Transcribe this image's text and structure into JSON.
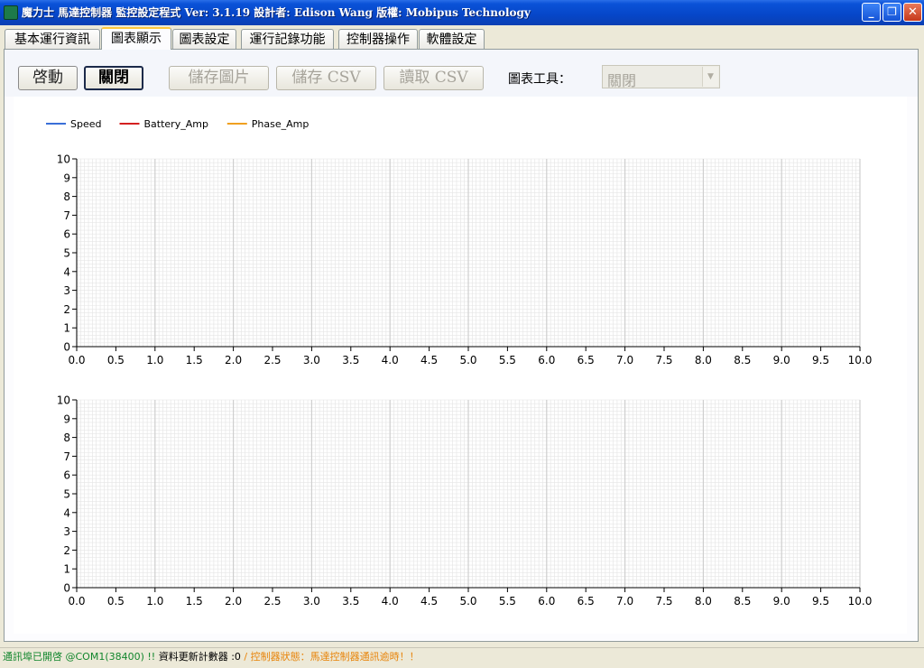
{
  "window": {
    "title": "魔力士 馬達控制器 監控設定程式   Ver: 3.1.19    設計者: Edison Wang  版權: Mobipus  Technology",
    "minimize_glyph": "_",
    "restore_glyph": "❐",
    "close_glyph": "✕"
  },
  "tabs": [
    {
      "label": "基本運行資訊",
      "active": false
    },
    {
      "label": "圖表顯示",
      "active": true
    },
    {
      "label": "圖表設定",
      "active": false
    },
    {
      "label": "運行記錄功能",
      "active": false
    },
    {
      "label": "控制器操作",
      "active": false
    },
    {
      "label": "軟體設定",
      "active": false
    }
  ],
  "toolbar": {
    "start_label": "啓動",
    "close_label": "關閉",
    "save_image_label": "儲存圖片",
    "save_csv_label": "儲存 CSV",
    "read_csv_label": "讀取 CSV",
    "chart_tools_label": "圖表工具：",
    "chart_tools_value": "關閉"
  },
  "chart_data": [
    {
      "type": "line",
      "series": [
        {
          "name": "Speed",
          "color": "#3a6fd8",
          "values": []
        },
        {
          "name": "Battery_Amp",
          "color": "#d42020",
          "values": []
        },
        {
          "name": "Phase_Amp",
          "color": "#f0a020",
          "values": []
        }
      ],
      "legend": "top-left",
      "xlim": [
        0,
        10
      ],
      "ylim": [
        0,
        10
      ],
      "xticks": [
        "0.0",
        "0.5",
        "1.0",
        "1.5",
        "2.0",
        "2.5",
        "3.0",
        "3.5",
        "4.0",
        "4.5",
        "5.0",
        "5.5",
        "6.0",
        "6.5",
        "7.0",
        "7.5",
        "8.0",
        "8.5",
        "9.0",
        "9.5",
        "10.0"
      ],
      "yticks": [
        "0",
        "1",
        "2",
        "3",
        "4",
        "5",
        "6",
        "7",
        "8",
        "9",
        "10"
      ],
      "grid": true
    },
    {
      "type": "line",
      "series": [],
      "xlim": [
        0,
        10
      ],
      "ylim": [
        0,
        10
      ],
      "xticks": [
        "0.0",
        "0.5",
        "1.0",
        "1.5",
        "2.0",
        "2.5",
        "3.0",
        "3.5",
        "4.0",
        "4.5",
        "5.0",
        "5.5",
        "6.0",
        "6.5",
        "7.0",
        "7.5",
        "8.0",
        "8.5",
        "9.0",
        "9.5",
        "10.0"
      ],
      "yticks": [
        "0",
        "1",
        "2",
        "3",
        "4",
        "5",
        "6",
        "7",
        "8",
        "9",
        "10"
      ],
      "grid": true
    }
  ],
  "status": {
    "port_text": "通訊埠已開啓 @COM1(38400) !!",
    "counter_text": " 資料更新計數器 :0",
    "controller_text": " / 控制器狀態：馬達控制器通訊逾時！！"
  }
}
